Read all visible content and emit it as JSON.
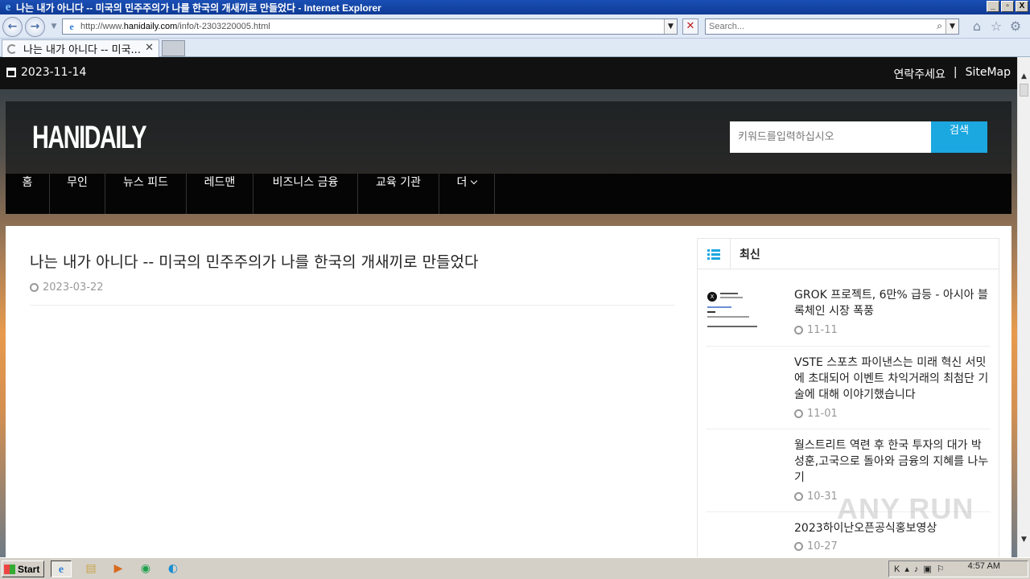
{
  "window": {
    "title": "나는 내가 아니다 -- 미국의 민주주의가 나를 한국의 개새끼로 만들었다 - Internet Explorer",
    "buttons": [
      "_",
      "▫",
      "X"
    ]
  },
  "browser": {
    "url_prefix": "http://www.",
    "url_domain": "hanidaily.com",
    "url_path": "/info/t-2303220005.html",
    "search_placeholder": "Search...",
    "tab_label": "나는 내가 아니다 -- 미국..."
  },
  "site": {
    "date": "2023-11-14",
    "top_links": [
      "연락주세요",
      "|",
      "SiteMap"
    ],
    "logo": "HANIDAILY",
    "search_placeholder": "키워드를입력하십시오",
    "search_button": "검색",
    "nav": [
      "홈",
      "무인",
      "뉴스 피드",
      "레드맨",
      "비즈니스 금융",
      "교육 기관",
      "더"
    ]
  },
  "article": {
    "title": "나는 내가 아니다 -- 미국의 민주주의가 나를 한국의 개새끼로 만들었다",
    "date": "2023-03-22"
  },
  "sidebar": {
    "title": "최신",
    "items": [
      {
        "title": "GROK 프로젝트, 6만% 급등 - 아시아 블록체인 시장 폭풍",
        "date": "11-11"
      },
      {
        "title": "VSTE 스포츠 파이낸스는 미래 혁신 서밋에 초대되어 이벤트 차익거래의 최첨단 기술에 대해 이야기했습니다",
        "date": "11-01"
      },
      {
        "title": "월스트리트 역련 후 한국 투자의 대가 박성훈,고국으로 돌아와 금융의 지혜를 나누기",
        "date": "10-31"
      },
      {
        "title": "2023하이난오픈공식홍보영상",
        "date": "10-27"
      }
    ]
  },
  "watermark": "ANY RUN",
  "taskbar": {
    "start": "Start",
    "time": "4:57 AM",
    "tray_lang": "K"
  },
  "colors": {
    "accent": "#1ba7e0",
    "topbar": "#111111",
    "titlebar": "#1a4fb5"
  }
}
